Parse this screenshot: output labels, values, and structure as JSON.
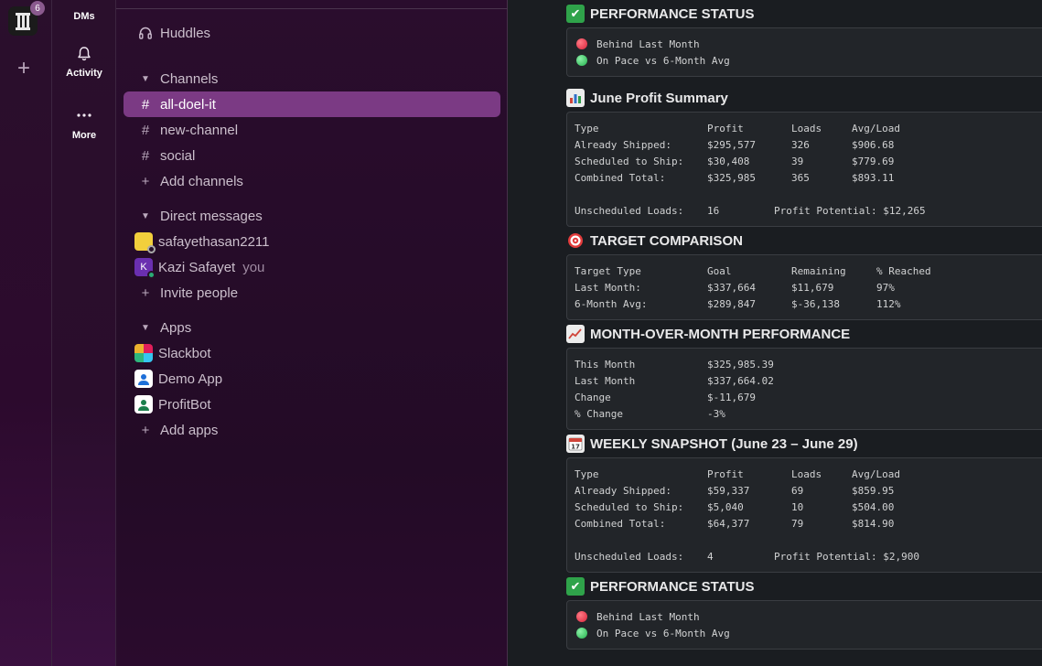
{
  "workspace": {
    "badge": "6"
  },
  "nav": {
    "dms": "DMs",
    "activity": "Activity",
    "more": "More"
  },
  "sidebar": {
    "huddles": "Huddles",
    "channels_header": "Channels",
    "channels": [
      "all-doel-it",
      "new-channel",
      "social"
    ],
    "add_channels": "Add channels",
    "dm_header": "Direct messages",
    "dms": [
      {
        "name": "safayethasan2211",
        "suffix": ""
      },
      {
        "name": "Kazi Safayet",
        "suffix": "you",
        "initial": "K"
      }
    ],
    "invite": "Invite people",
    "apps_header": "Apps",
    "apps": [
      "Slackbot",
      "Demo App",
      "ProfitBot"
    ],
    "add_apps": "Add apps"
  },
  "colors": {
    "accent_active": "#7b3a84",
    "status_red": "#d9233a",
    "status_green": "#22b14c"
  },
  "main": {
    "perf1": {
      "title": "PERFORMANCE STATUS",
      "lines": [
        "Behind Last Month",
        "On Pace vs 6-Month Avg"
      ]
    },
    "june": {
      "title": "June Profit Summary",
      "header": [
        "Type",
        "Profit",
        "Loads",
        "Avg/Load"
      ],
      "rows": [
        [
          "Already Shipped:",
          "$295,577",
          "326",
          "$906.68"
        ],
        [
          "Scheduled to Ship:",
          "$30,408",
          "39",
          "$779.69"
        ],
        [
          "Combined Total:",
          "$325,985",
          "365",
          "$893.11"
        ]
      ],
      "footer": {
        "label": "Unscheduled Loads:",
        "value": "16",
        "potential": "Profit Potential: $12,265"
      }
    },
    "target": {
      "title": "TARGET COMPARISON",
      "header": [
        "Target Type",
        "Goal",
        "Remaining",
        "% Reached"
      ],
      "rows": [
        [
          "Last Month:",
          "$337,664",
          "$11,679",
          "97%"
        ],
        [
          "6-Month Avg:",
          "$289,847",
          "$-36,138",
          "112%"
        ]
      ]
    },
    "mom": {
      "title": "MONTH-OVER-MONTH PERFORMANCE",
      "rows": [
        [
          "This Month",
          "$325,985.39"
        ],
        [
          "Last Month",
          "$337,664.02"
        ],
        [
          "Change",
          "$-11,679"
        ],
        [
          "% Change",
          "-3%"
        ]
      ]
    },
    "weekly": {
      "title": "WEEKLY SNAPSHOT (June 23 – June 29)",
      "header": [
        "Type",
        "Profit",
        "Loads",
        "Avg/Load"
      ],
      "rows": [
        [
          "Already Shipped:",
          "$59,337",
          "69",
          "$859.95"
        ],
        [
          "Scheduled to Ship:",
          "$5,040",
          "10",
          "$504.00"
        ],
        [
          "Combined Total:",
          "$64,377",
          "79",
          "$814.90"
        ]
      ],
      "footer": {
        "label": "Unscheduled Loads:",
        "value": "4",
        "potential": "Profit Potential: $2,900"
      }
    },
    "perf2": {
      "title": "PERFORMANCE STATUS",
      "lines": [
        "Behind Last Month",
        "On Pace vs 6-Month Avg"
      ]
    }
  }
}
